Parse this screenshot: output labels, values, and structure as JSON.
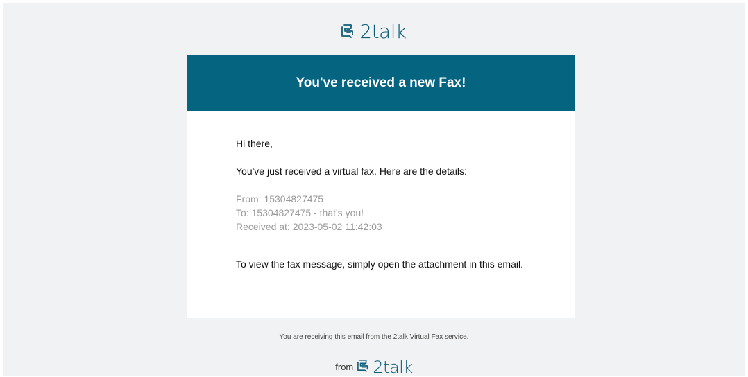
{
  "brand": {
    "name": "2talk",
    "color": "#0f5e78",
    "icon": "2talk-logo-icon"
  },
  "banner": {
    "title": "You've received a new Fax!",
    "color": "#056480"
  },
  "email": {
    "greeting": "Hi there,",
    "intro": "You've just received a virtual fax. Here are the details:",
    "details": {
      "from": "From: 15304827475",
      "to": "To: 15304827475 - that's you!",
      "received": "Received at: 2023-05-02 11:42:03"
    },
    "instruction": "To view the fax message, simply open the attachment in this email."
  },
  "footer": {
    "note": "You are receiving this email from the 2talk Virtual Fax service.",
    "from_label": "from"
  }
}
